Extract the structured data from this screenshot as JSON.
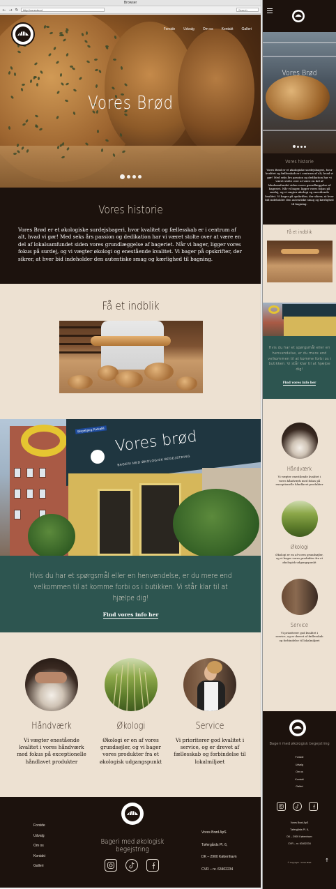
{
  "browser": {
    "window_title": "Browser",
    "url": "http://voresbrod",
    "search_placeholder": "Search",
    "back_glyph": "←",
    "forward_glyph": "→",
    "reload_glyph": "↻"
  },
  "nav": {
    "items": [
      "Forside",
      "Udvalg",
      "Om os",
      "Kontakt",
      "Galleri"
    ]
  },
  "hero": {
    "title": "Vores Brød",
    "slide_count": 4,
    "active_slide": 1
  },
  "story": {
    "heading": "Vores historie",
    "body": "Vores Brød er et økologiske surdejsbageri, hvor kvalitet og fællesskab er i centrum af alt, hvad vi gør! Med seks års passion og dedikation har vi været stolte over at være en del af lokalsamfundet siden vores grundlæggelse af bageriet. Når vi bager, ligger vores fokus på surdej, og vi vægter økologi og enestående kvalitet. Vi bager på opskrifter, der sikrer, at hver bid indeholder den autentiske smag og kærlighed til bagning."
  },
  "insight": {
    "heading": "Få et indblik"
  },
  "storefront": {
    "sign_text": "Vores brød",
    "sign_subtitle": "BAGERI MED ØKOLOGISK BEGEJSTRING",
    "street_sign": "Bispebjerg Parkallé"
  },
  "contact": {
    "text": "Hvis du har et spørgsmål eller en henvendelse, er du mere end velkommen til at komme forbi os i butikken. Vi står klar til at hjælpe dig!",
    "link_label": "Find vores info her"
  },
  "features": [
    {
      "title": "Håndværk",
      "text": "Vi vægter enestående kvalitet i vores håndværk med fokus på exceptionelle håndlavet produkter",
      "icon": "flour-hands-icon"
    },
    {
      "title": "Økologi",
      "text": "Økologi er en af vores grundsøjler, og vi bager vores produkter fra et økologisk udgangspunkt",
      "icon": "wheat-field-icon"
    },
    {
      "title": "Service",
      "text": "Vi prioriterer god kvalitet i service, og er drevet af fællesskab og forbindelse til lokalmiljøet",
      "icon": "baker-portrait-icon"
    }
  ],
  "footer": {
    "tagline": "Bageri med økologisk begejstring",
    "links": [
      "Forside",
      "Udvalg",
      "Om os",
      "Kontakt",
      "Galleri"
    ],
    "address": [
      "Vores Brød ApS",
      "Tøfergårds Pl. 6,",
      "DK – 2900 København",
      "CVR – nr. 63402234"
    ],
    "socials": [
      "instagram-icon",
      "tiktok-icon",
      "facebook-icon"
    ],
    "copyright": "© Copyright · Vores Brød"
  },
  "mobile": {
    "back_to_top": "↑"
  },
  "colors": {
    "dark": "#1c120d",
    "cream": "#ede1d2",
    "teal": "#2d5550",
    "accent_text": "#e8ded0"
  }
}
